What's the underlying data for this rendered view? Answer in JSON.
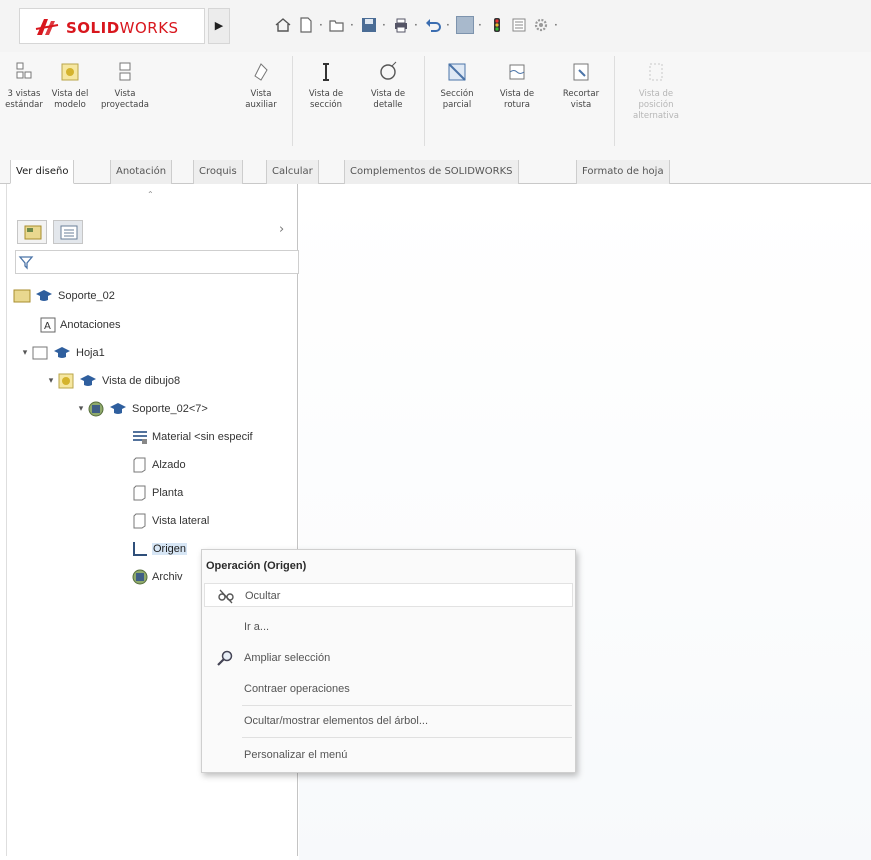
{
  "app": {
    "logo_text_bold": "SOLID",
    "logo_text_thin": "WORKS",
    "brand_color": "#d8161d"
  },
  "quick_access": [
    {
      "name": "home",
      "icon": "home-icon"
    },
    {
      "name": "new-document",
      "icon": "new-document-icon"
    },
    {
      "name": "open",
      "icon": "folder-open-icon"
    },
    {
      "name": "save",
      "icon": "save-icon"
    },
    {
      "name": "print",
      "icon": "print-icon"
    },
    {
      "name": "undo",
      "icon": "undo-icon"
    },
    {
      "name": "select",
      "icon": "select-arrow-icon"
    },
    {
      "name": "rebuild",
      "icon": "traffic-light-icon"
    },
    {
      "name": "file-properties",
      "icon": "file-properties-icon"
    },
    {
      "name": "options",
      "icon": "gear-icon"
    }
  ],
  "ribbon": {
    "buttons": [
      {
        "label": "3 vistas\nestándar",
        "icon": "three-views-icon",
        "enabled": true
      },
      {
        "label": "Vista del\nmodelo",
        "icon": "model-view-icon",
        "enabled": true
      },
      {
        "label": "Vista\nproyectada",
        "icon": "projected-view-icon",
        "enabled": true
      },
      {
        "label": "Vista\nauxiliar",
        "icon": "auxiliary-view-icon",
        "enabled": true
      },
      {
        "label": "Vista de\nsección",
        "icon": "section-view-icon",
        "enabled": true
      },
      {
        "label": "Vista de\ndetalle",
        "icon": "detail-view-icon",
        "enabled": true
      },
      {
        "label": "Sección\nparcial",
        "icon": "broken-out-section-icon",
        "enabled": true
      },
      {
        "label": "Vista de\nrotura",
        "icon": "break-view-icon",
        "enabled": true
      },
      {
        "label": "Recortar\nvista",
        "icon": "crop-view-icon",
        "enabled": true
      },
      {
        "label": "Vista de\nposición\nalternativa",
        "icon": "alternate-position-icon",
        "enabled": false
      }
    ]
  },
  "tabs": [
    {
      "label": "Ver diseño",
      "active": true
    },
    {
      "label": "Anotación",
      "active": false
    },
    {
      "label": "Croquis",
      "active": false
    },
    {
      "label": "Calcular",
      "active": false
    },
    {
      "label": "Complementos de SOLIDWORKS",
      "active": false
    },
    {
      "label": "Formato de hoja",
      "active": false
    }
  ],
  "panel": {
    "tabs": [
      {
        "icon": "featuremanager-icon",
        "active": false
      },
      {
        "icon": "property-manager-icon",
        "active": true
      }
    ],
    "more_glyph": "›",
    "filter_icon": "filter-icon"
  },
  "tree": [
    {
      "label": "Soporte_02",
      "icon": "drawing-icon"
    },
    {
      "label": "Anotaciones",
      "icon": "annotations-icon"
    },
    {
      "label": "Hoja1",
      "icon": "sheet-icon"
    },
    {
      "label": "Vista de dibujo8",
      "icon": "drawing-view-icon"
    },
    {
      "label": "Soporte_02<7>",
      "icon": "part-icon"
    },
    {
      "label": "Material <sin especif",
      "icon": "material-icon"
    },
    {
      "label": "Alzado",
      "icon": "plane-icon"
    },
    {
      "label": "Planta",
      "icon": "plane-icon"
    },
    {
      "label": "Vista lateral",
      "icon": "plane-icon"
    },
    {
      "label": "Origen",
      "icon": "origin-icon"
    },
    {
      "label": "Archiv",
      "icon": "feature-icon"
    }
  ],
  "context_menu": {
    "title": "Operación (Origen)",
    "items": [
      {
        "label": "Ocultar",
        "icon": "hide-glasses-icon",
        "hover": true
      },
      {
        "label": "Ir a...",
        "icon": "",
        "hover": false
      },
      {
        "label": "Ampliar selección",
        "icon": "zoom-selection-icon",
        "hover": false
      },
      {
        "label": "Contraer operaciones",
        "icon": "",
        "hover": false
      },
      {
        "label": "Ocultar/mostrar elementos del árbol...",
        "icon": "",
        "hover": false
      },
      {
        "label": "Personalizar el menú",
        "icon": "",
        "hover": false
      }
    ]
  }
}
